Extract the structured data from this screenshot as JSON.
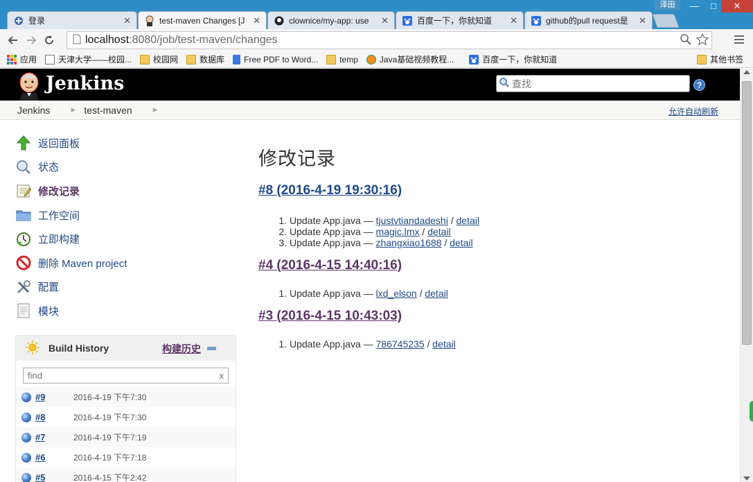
{
  "window": {
    "user_label": "泽田",
    "min": "—",
    "max": "□",
    "close": "✕"
  },
  "tabs": [
    {
      "title": "登录",
      "icon": "jenkins-logo-icon",
      "active": false
    },
    {
      "title": "test-maven Changes [J",
      "icon": "jenkins-butler-icon",
      "active": true
    },
    {
      "title": "clownice/my-app: use",
      "icon": "github-icon",
      "active": false
    },
    {
      "title": "百度一下，你就知道",
      "icon": "baidu-paw-icon",
      "active": false
    },
    {
      "title": "github的pull request是",
      "icon": "baidu-paw-icon",
      "active": false
    }
  ],
  "toolbar": {
    "url_host": "localhost",
    "url_path": ":8080/job/test-maven/changes"
  },
  "bookmarks": [
    {
      "label": "应用",
      "icon": "apps-grid-icon"
    },
    {
      "label": "天津大学——校园...",
      "icon": "page-icon"
    },
    {
      "label": "校园网",
      "icon": "folder-icon"
    },
    {
      "label": "数据库",
      "icon": "folder-icon"
    },
    {
      "label": "Free PDF to Word...",
      "icon": "docs-icon"
    },
    {
      "label": "temp",
      "icon": "folder-icon"
    },
    {
      "label": "Java基础视频教程...",
      "icon": "video-site-icon"
    },
    {
      "label": "百度一下，你就知道",
      "icon": "baidu-paw-icon"
    },
    {
      "label": "其他书签",
      "icon": "folder-icon"
    }
  ],
  "header": {
    "title": "Jenkins",
    "search_placeholder": "查找",
    "help": "?"
  },
  "breadcrumb": {
    "items": [
      "Jenkins",
      "test-maven"
    ],
    "sep": "▶",
    "autorefresh": "允许自动刷新"
  },
  "tasks": [
    {
      "label": "返回面板",
      "icon": "up-arrow-icon",
      "current": false
    },
    {
      "label": "状态",
      "icon": "magnifier-icon",
      "current": false
    },
    {
      "label": "修改记录",
      "icon": "notepad-icon",
      "current": true
    },
    {
      "label": "工作空间",
      "icon": "folder-icon",
      "current": false
    },
    {
      "label": "立即构建",
      "icon": "clock-build-icon",
      "current": false
    },
    {
      "label": "删除 Maven project",
      "icon": "no-entry-icon",
      "current": false
    },
    {
      "label": "配置",
      "icon": "tools-icon",
      "current": false
    },
    {
      "label": "模块",
      "icon": "document-icon",
      "current": false
    }
  ],
  "build_history": {
    "title": "Build History",
    "trend": "构建历史",
    "filter_placeholder": "find",
    "clear": "x",
    "builds": [
      {
        "num": "#9",
        "date": "2016-4-19 下午7:30"
      },
      {
        "num": "#8",
        "date": "2016-4-19 下午7:30"
      },
      {
        "num": "#7",
        "date": "2016-4-19 下午7:19"
      },
      {
        "num": "#6",
        "date": "2016-4-19 下午7:18"
      },
      {
        "num": "#5",
        "date": "2016-4-15 下午2:42"
      }
    ]
  },
  "main": {
    "page_title": "修改记录",
    "changesets": [
      {
        "heading": "#8 (2016-4-19 19:30:16)",
        "visited": false,
        "changes": [
          {
            "msg": "Update App.java — ",
            "author": "tjustvtiandadeshi",
            "sep": " / ",
            "detail": "detail"
          },
          {
            "msg": "Update App.java — ",
            "author": "magic.lmx",
            "sep": " / ",
            "detail": "detail"
          },
          {
            "msg": "Update App.java — ",
            "author": "zhangxiao1688",
            "sep": " / ",
            "detail": "detail"
          }
        ]
      },
      {
        "heading": "#4 (2016-4-15 14:40:16)",
        "visited": true,
        "changes": [
          {
            "msg": "Update App.java — ",
            "author": "lxd_elson",
            "sep": " / ",
            "detail": "detail"
          }
        ]
      },
      {
        "heading": "#3 (2016-4-15 10:43:03)",
        "visited": true,
        "changes": [
          {
            "msg": "Update App.java — ",
            "author": "786745235",
            "sep": " / ",
            "detail": "detail"
          }
        ]
      }
    ]
  },
  "colors": {
    "link": "#204a87",
    "visited": "#5c3566",
    "tabstrip": "#2d8ec7",
    "header": "#000000"
  }
}
